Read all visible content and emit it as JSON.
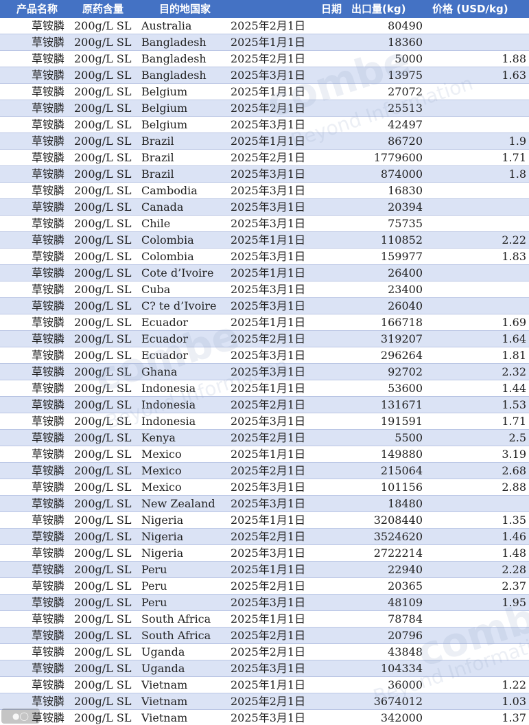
{
  "header": {
    "product": "产品名称",
    "spec": "原药含量",
    "destination": "目的地国家",
    "date": "日期",
    "quantity": "出口量(kg)",
    "price": "价格 (USD/kg)"
  },
  "watermark": {
    "brand": "combe",
    "tagline": "Beyond Information"
  },
  "footer": {
    "logo_icon": "camera-icon"
  },
  "rows": [
    {
      "product": "草铵膦",
      "spec": "200g/L SL",
      "destination": "Australia",
      "date": "2025年2月1日",
      "quantity": "80490",
      "price": ""
    },
    {
      "product": "草铵膦",
      "spec": "200g/L SL",
      "destination": "Bangladesh",
      "date": "2025年1月1日",
      "quantity": "18360",
      "price": ""
    },
    {
      "product": "草铵膦",
      "spec": "200g/L SL",
      "destination": "Bangladesh",
      "date": "2025年2月1日",
      "quantity": "5000",
      "price": "1.88"
    },
    {
      "product": "草铵膦",
      "spec": "200g/L SL",
      "destination": "Bangladesh",
      "date": "2025年3月1日",
      "quantity": "13975",
      "price": "1.63"
    },
    {
      "product": "草铵膦",
      "spec": "200g/L SL",
      "destination": "Belgium",
      "date": "2025年1月1日",
      "quantity": "27072",
      "price": ""
    },
    {
      "product": "草铵膦",
      "spec": "200g/L SL",
      "destination": "Belgium",
      "date": "2025年2月1日",
      "quantity": "25513",
      "price": ""
    },
    {
      "product": "草铵膦",
      "spec": "200g/L SL",
      "destination": "Belgium",
      "date": "2025年3月1日",
      "quantity": "42497",
      "price": ""
    },
    {
      "product": "草铵膦",
      "spec": "200g/L SL",
      "destination": "Brazil",
      "date": "2025年1月1日",
      "quantity": "86720",
      "price": "1.9"
    },
    {
      "product": "草铵膦",
      "spec": "200g/L SL",
      "destination": "Brazil",
      "date": "2025年2月1日",
      "quantity": "1779600",
      "price": "1.71"
    },
    {
      "product": "草铵膦",
      "spec": "200g/L SL",
      "destination": "Brazil",
      "date": "2025年3月1日",
      "quantity": "874000",
      "price": "1.8"
    },
    {
      "product": "草铵膦",
      "spec": "200g/L SL",
      "destination": "Cambodia",
      "date": "2025年3月1日",
      "quantity": "16830",
      "price": ""
    },
    {
      "product": "草铵膦",
      "spec": "200g/L SL",
      "destination": "Canada",
      "date": "2025年3月1日",
      "quantity": "20394",
      "price": ""
    },
    {
      "product": "草铵膦",
      "spec": "200g/L SL",
      "destination": "Chile",
      "date": "2025年3月1日",
      "quantity": "75735",
      "price": ""
    },
    {
      "product": "草铵膦",
      "spec": "200g/L SL",
      "destination": "Colombia",
      "date": "2025年1月1日",
      "quantity": "110852",
      "price": "2.22"
    },
    {
      "product": "草铵膦",
      "spec": "200g/L SL",
      "destination": "Colombia",
      "date": "2025年3月1日",
      "quantity": "159977",
      "price": "1.83"
    },
    {
      "product": "草铵膦",
      "spec": "200g/L SL",
      "destination": "Cote d’Ivoire",
      "date": "2025年1月1日",
      "quantity": "26400",
      "price": ""
    },
    {
      "product": "草铵膦",
      "spec": "200g/L SL",
      "destination": "Cuba",
      "date": "2025年3月1日",
      "quantity": "23400",
      "price": ""
    },
    {
      "product": "草铵膦",
      "spec": "200g/L SL",
      "destination": "C? te d’Ivoire",
      "date": "2025年3月1日",
      "quantity": "26040",
      "price": ""
    },
    {
      "product": "草铵膦",
      "spec": "200g/L SL",
      "destination": "Ecuador",
      "date": "2025年1月1日",
      "quantity": "166718",
      "price": "1.69"
    },
    {
      "product": "草铵膦",
      "spec": "200g/L SL",
      "destination": "Ecuador",
      "date": "2025年2月1日",
      "quantity": "319207",
      "price": "1.64"
    },
    {
      "product": "草铵膦",
      "spec": "200g/L SL",
      "destination": "Ecuador",
      "date": "2025年3月1日",
      "quantity": "296264",
      "price": "1.81"
    },
    {
      "product": "草铵膦",
      "spec": "200g/L SL",
      "destination": "Ghana",
      "date": "2025年3月1日",
      "quantity": "92702",
      "price": "2.32"
    },
    {
      "product": "草铵膦",
      "spec": "200g/L SL",
      "destination": "Indonesia",
      "date": "2025年1月1日",
      "quantity": "53600",
      "price": "1.44"
    },
    {
      "product": "草铵膦",
      "spec": "200g/L SL",
      "destination": "Indonesia",
      "date": "2025年2月1日",
      "quantity": "131671",
      "price": "1.53"
    },
    {
      "product": "草铵膦",
      "spec": "200g/L SL",
      "destination": "Indonesia",
      "date": "2025年3月1日",
      "quantity": "191591",
      "price": "1.71"
    },
    {
      "product": "草铵膦",
      "spec": "200g/L SL",
      "destination": "Kenya",
      "date": "2025年2月1日",
      "quantity": "5500",
      "price": "2.5"
    },
    {
      "product": "草铵膦",
      "spec": "200g/L SL",
      "destination": "Mexico",
      "date": "2025年1月1日",
      "quantity": "149880",
      "price": "3.19"
    },
    {
      "product": "草铵膦",
      "spec": "200g/L SL",
      "destination": "Mexico",
      "date": "2025年2月1日",
      "quantity": "215064",
      "price": "2.68"
    },
    {
      "product": "草铵膦",
      "spec": "200g/L SL",
      "destination": "Mexico",
      "date": "2025年3月1日",
      "quantity": "101156",
      "price": "2.88"
    },
    {
      "product": "草铵膦",
      "spec": "200g/L SL",
      "destination": "New Zealand",
      "date": "2025年3月1日",
      "quantity": "18480",
      "price": ""
    },
    {
      "product": "草铵膦",
      "spec": "200g/L SL",
      "destination": "Nigeria",
      "date": "2025年1月1日",
      "quantity": "3208440",
      "price": "1.35"
    },
    {
      "product": "草铵膦",
      "spec": "200g/L SL",
      "destination": "Nigeria",
      "date": "2025年2月1日",
      "quantity": "3524620",
      "price": "1.46"
    },
    {
      "product": "草铵膦",
      "spec": "200g/L SL",
      "destination": "Nigeria",
      "date": "2025年3月1日",
      "quantity": "2722214",
      "price": "1.48"
    },
    {
      "product": "草铵膦",
      "spec": "200g/L SL",
      "destination": "Peru",
      "date": "2025年1月1日",
      "quantity": "22940",
      "price": "2.28"
    },
    {
      "product": "草铵膦",
      "spec": "200g/L SL",
      "destination": "Peru",
      "date": "2025年2月1日",
      "quantity": "20365",
      "price": "2.37"
    },
    {
      "product": "草铵膦",
      "spec": "200g/L SL",
      "destination": "Peru",
      "date": "2025年3月1日",
      "quantity": "48109",
      "price": "1.95"
    },
    {
      "product": "草铵膦",
      "spec": "200g/L SL",
      "destination": "South Africa",
      "date": "2025年1月1日",
      "quantity": "78784",
      "price": ""
    },
    {
      "product": "草铵膦",
      "spec": "200g/L SL",
      "destination": "South Africa",
      "date": "2025年2月1日",
      "quantity": "20796",
      "price": ""
    },
    {
      "product": "草铵膦",
      "spec": "200g/L SL",
      "destination": "Uganda",
      "date": "2025年2月1日",
      "quantity": "43848",
      "price": ""
    },
    {
      "product": "草铵膦",
      "spec": "200g/L SL",
      "destination": "Uganda",
      "date": "2025年3月1日",
      "quantity": "104334",
      "price": ""
    },
    {
      "product": "草铵膦",
      "spec": "200g/L SL",
      "destination": "Vietnam",
      "date": "2025年1月1日",
      "quantity": "36000",
      "price": "1.22"
    },
    {
      "product": "草铵膦",
      "spec": "200g/L SL",
      "destination": "Vietnam",
      "date": "2025年2月1日",
      "quantity": "3674012",
      "price": "1.03"
    },
    {
      "product": "草铵膦",
      "spec": "200g/L SL",
      "destination": "Vietnam",
      "date": "2025年3月1日",
      "quantity": "342000",
      "price": "1.37"
    }
  ]
}
